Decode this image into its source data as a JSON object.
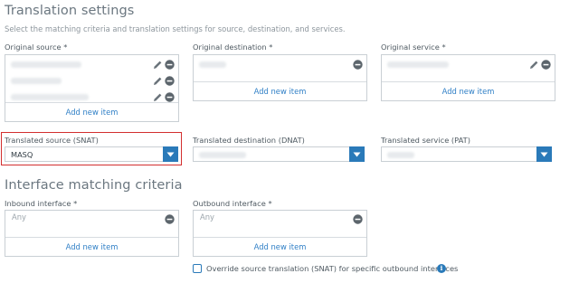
{
  "translation": {
    "title": "Translation settings",
    "subtitle": "Select the matching criteria and translation settings for source, destination, and services.",
    "original_source": {
      "label": "Original source *",
      "add_label": "Add new item"
    },
    "original_destination": {
      "label": "Original destination *",
      "add_label": "Add new item"
    },
    "original_service": {
      "label": "Original service *",
      "add_label": "Add new item"
    },
    "translated_source": {
      "label": "Translated source (SNAT)",
      "value": "MASQ"
    },
    "translated_destination": {
      "label": "Translated destination (DNAT)"
    },
    "translated_service": {
      "label": "Translated service (PAT)"
    }
  },
  "interface": {
    "title": "Interface matching criteria",
    "inbound": {
      "label": "Inbound interface *",
      "value": "Any",
      "add_label": "Add new item"
    },
    "outbound": {
      "label": "Outbound interface *",
      "value": "Any",
      "add_label": "Add new item"
    },
    "override_label": "Override source translation (SNAT) for specific outbound interfaces",
    "info_icon_text": "i"
  },
  "colors": {
    "accent": "#2a7ab9",
    "link": "#2f7fc6",
    "highlight": "#d32f2f",
    "border": "#c9cfd4"
  },
  "icons": [
    "pencil-icon",
    "minus-circle-icon",
    "chevron-down-icon",
    "info-icon",
    "checkbox"
  ]
}
